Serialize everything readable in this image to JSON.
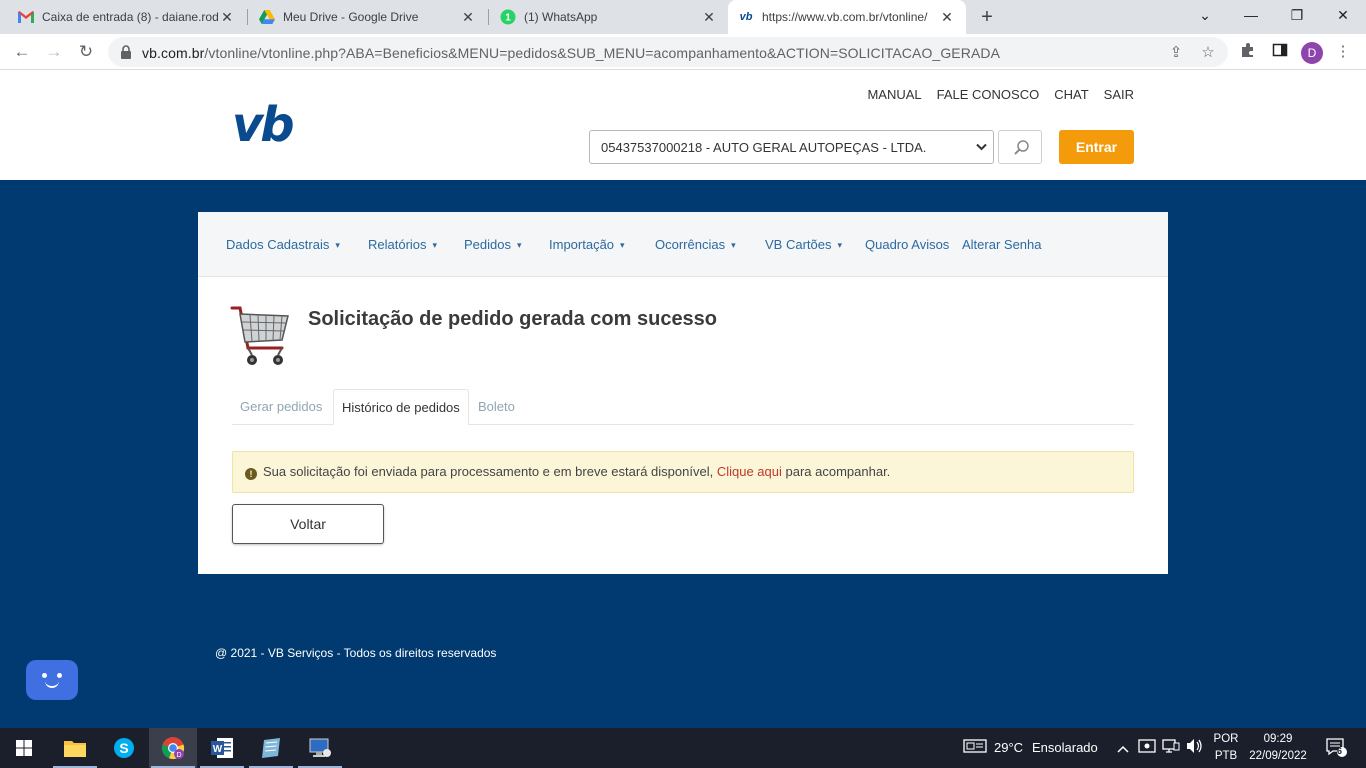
{
  "browser": {
    "tabs": [
      {
        "title": "Caixa de entrada (8) - daiane.rod",
        "icon": "gmail-icon"
      },
      {
        "title": "Meu Drive - Google Drive",
        "icon": "google-drive-icon"
      },
      {
        "title": "(1) WhatsApp",
        "icon": "whatsapp-icon"
      },
      {
        "title": "https://www.vb.com.br/vtonline/",
        "icon": "vb-icon"
      }
    ],
    "url_host": "vb.com.br",
    "url_path": "/vtonline/vtonline.php?ABA=Beneficios&MENU=pedidos&SUB_MENU=acompanhamento&ACTION=SOLICITACAO_GERADA",
    "profile_initial": "D"
  },
  "site": {
    "logo_text": "vb",
    "top_links": [
      "MANUAL",
      "FALE CONOSCO",
      "CHAT",
      "SAIR"
    ],
    "company_select_value": "05437537000218 - AUTO GERAL AUTOPEÇAS - LTDA.",
    "entrar_label": "Entrar",
    "brand_color": "#003a70",
    "accent_color": "#f49b0b"
  },
  "menu": {
    "items": [
      {
        "label": "Dados Cadastrais",
        "has_dropdown": true
      },
      {
        "label": "Relatórios",
        "has_dropdown": true
      },
      {
        "label": "Pedidos",
        "has_dropdown": true
      },
      {
        "label": "Importação",
        "has_dropdown": true
      },
      {
        "label": "Ocorrências",
        "has_dropdown": true
      },
      {
        "label": "VB Cartões",
        "has_dropdown": true
      },
      {
        "label": "Quadro Avisos",
        "has_dropdown": false
      },
      {
        "label": "Alterar Senha",
        "has_dropdown": false
      }
    ]
  },
  "main": {
    "title": "Solicitação de pedido gerada com sucesso",
    "tabs": [
      "Gerar pedidos",
      "Histórico de pedidos",
      "Boleto"
    ],
    "active_tab": "Histórico de pedidos",
    "alert": {
      "text_before": "Sua solicitação foi enviada para processamento e em breve estará disponível,",
      "link": "Clique aqui",
      "text_after": "para acompanhar."
    },
    "back_button": "Voltar"
  },
  "footer": {
    "text": "@ 2021 - VB Serviços - Todos os direitos reservados"
  },
  "taskbar": {
    "weather_temp": "29°C",
    "weather_text": "Ensolarado",
    "lang_line1": "POR",
    "lang_line2": "PTB",
    "time": "09:29",
    "date": "22/09/2022",
    "notifications": "6"
  }
}
